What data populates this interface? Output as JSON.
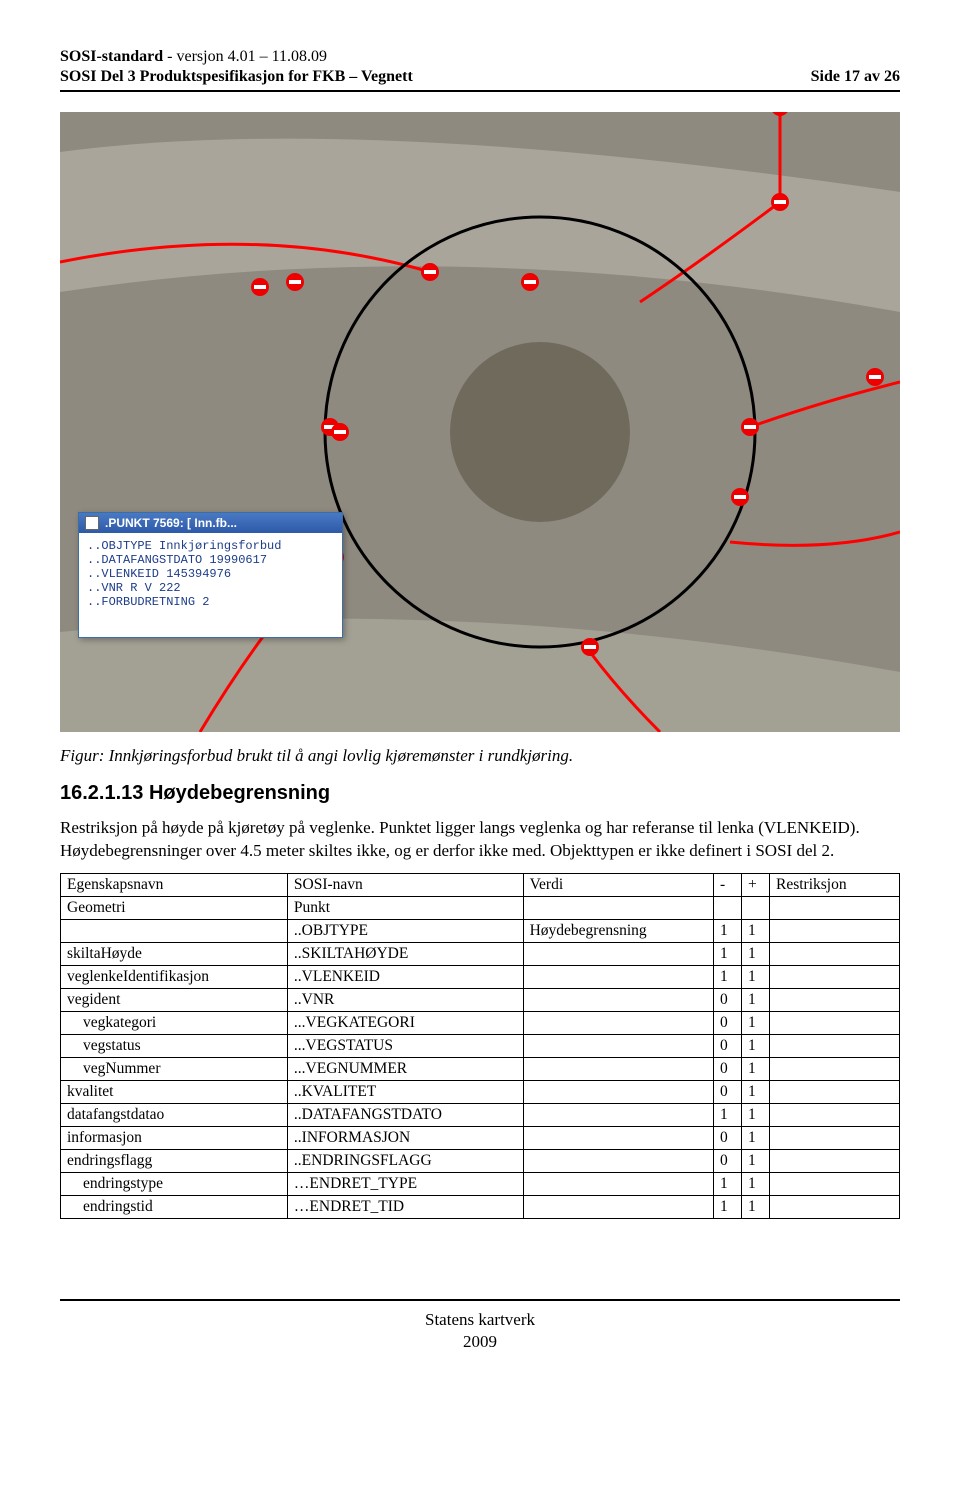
{
  "header": {
    "std_label": "SOSI-standard",
    "std_suffix": " - versjon 4.01 – 11.08.09",
    "doc_title": "SOSI Del 3 Produktspesifikasjon for FKB – Vegnett",
    "page_label": "Side 17 av 26"
  },
  "prop_window": {
    "title": ".PUNKT 7569:  [  Inn.fb... ",
    "lines": [
      "..OBJTYPE Innkjøringsforbud",
      "..DATAFANGSTDATO 19990617",
      "..VLENKEID 145394976",
      "..VNR R V 222",
      "..FORBUDRETNING 2"
    ]
  },
  "caption": "Figur: Innkjøringsforbud brukt til å angi lovlig kjøremønster i rundkjøring.",
  "section": {
    "number": "16.2.1.13",
    "title": "Høydebegrensning"
  },
  "body_text": "Restriksjon på høyde på kjøretøy på veglenke. Punktet ligger langs veglenka og har referanse til lenka (VLENKEID). Høydebegrensninger over 4.5 meter skiltes ikke, og er derfor ikke med. Objekttypen er ikke definert i SOSI del 2.",
  "table": {
    "headers": {
      "c1": "Egenskapsnavn",
      "c2": "SOSI-navn",
      "c3": "Verdi",
      "c4": "-",
      "c5": "+",
      "c6": "Restriksjon"
    },
    "rows": [
      {
        "c1": "Geometri",
        "c2": "Punkt",
        "c3": "",
        "c4": "",
        "c5": "",
        "c6": "",
        "indent": false
      },
      {
        "c1": "",
        "c2": "..OBJTYPE",
        "c3": "Høydebegrensning",
        "c4": "1",
        "c5": "1",
        "c6": "",
        "indent": false
      },
      {
        "c1": "skiltaHøyde",
        "c2": "..SKILTAHØYDE",
        "c3": "",
        "c4": "1",
        "c5": "1",
        "c6": "",
        "indent": false
      },
      {
        "c1": "veglenkeIdentifikasjon",
        "c2": "..VLENKEID",
        "c3": "",
        "c4": "1",
        "c5": "1",
        "c6": "",
        "indent": false
      },
      {
        "c1": "vegident",
        "c2": "..VNR",
        "c3": "",
        "c4": "0",
        "c5": "1",
        "c6": "",
        "indent": false
      },
      {
        "c1": "vegkategori",
        "c2": "...VEGKATEGORI",
        "c3": "",
        "c4": "0",
        "c5": "1",
        "c6": "",
        "indent": true
      },
      {
        "c1": "vegstatus",
        "c2": "...VEGSTATUS",
        "c3": "",
        "c4": "0",
        "c5": "1",
        "c6": "",
        "indent": true
      },
      {
        "c1": "vegNummer",
        "c2": "...VEGNUMMER",
        "c3": "",
        "c4": "0",
        "c5": "1",
        "c6": "",
        "indent": true
      },
      {
        "c1": "kvalitet",
        "c2": "..KVALITET",
        "c3": "",
        "c4": "0",
        "c5": "1",
        "c6": "",
        "indent": false
      },
      {
        "c1": "datafangstdatao",
        "c2": "..DATAFANGSTDATO",
        "c3": "",
        "c4": "1",
        "c5": "1",
        "c6": "",
        "indent": false
      },
      {
        "c1": "informasjon",
        "c2": "..INFORMASJON",
        "c3": "",
        "c4": "0",
        "c5": "1",
        "c6": "",
        "indent": false
      },
      {
        "c1": "endringsflagg",
        "c2": "..ENDRINGSFLAGG",
        "c3": "",
        "c4": "0",
        "c5": "1",
        "c6": "",
        "indent": false
      },
      {
        "c1": "endringstype",
        "c2": "…ENDRET_TYPE",
        "c3": "",
        "c4": "1",
        "c5": "1",
        "c6": "",
        "indent": true
      },
      {
        "c1": "endringstid",
        "c2": "…ENDRET_TID",
        "c3": "",
        "c4": "1",
        "c5": "1",
        "c6": "",
        "indent": true
      }
    ]
  },
  "footer": {
    "org": "Statens kartverk",
    "year": "2009"
  }
}
